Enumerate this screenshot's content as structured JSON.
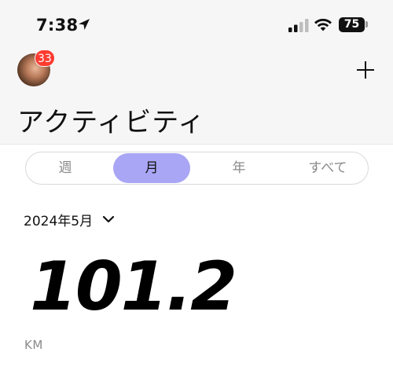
{
  "status_bar": {
    "time": "7:38",
    "battery": "75",
    "icons": [
      "location-arrow-icon",
      "cellular-signal-icon",
      "wifi-icon",
      "battery-icon"
    ]
  },
  "header": {
    "avatar_badge": "33",
    "add_icon": "plus-icon",
    "title": "アクティビティ"
  },
  "segments": {
    "items": [
      {
        "label": "週",
        "active": false
      },
      {
        "label": "月",
        "active": true
      },
      {
        "label": "年",
        "active": false
      },
      {
        "label": "すべて",
        "active": false
      }
    ],
    "accent_color": "#a9a6f5"
  },
  "period": {
    "label": "2024年5月",
    "icon": "chevron-down-icon"
  },
  "summary": {
    "distance": "101.2",
    "unit": "KM"
  },
  "colors": {
    "header_bg": "#f6f6f6",
    "badge": "#ff3b30"
  }
}
